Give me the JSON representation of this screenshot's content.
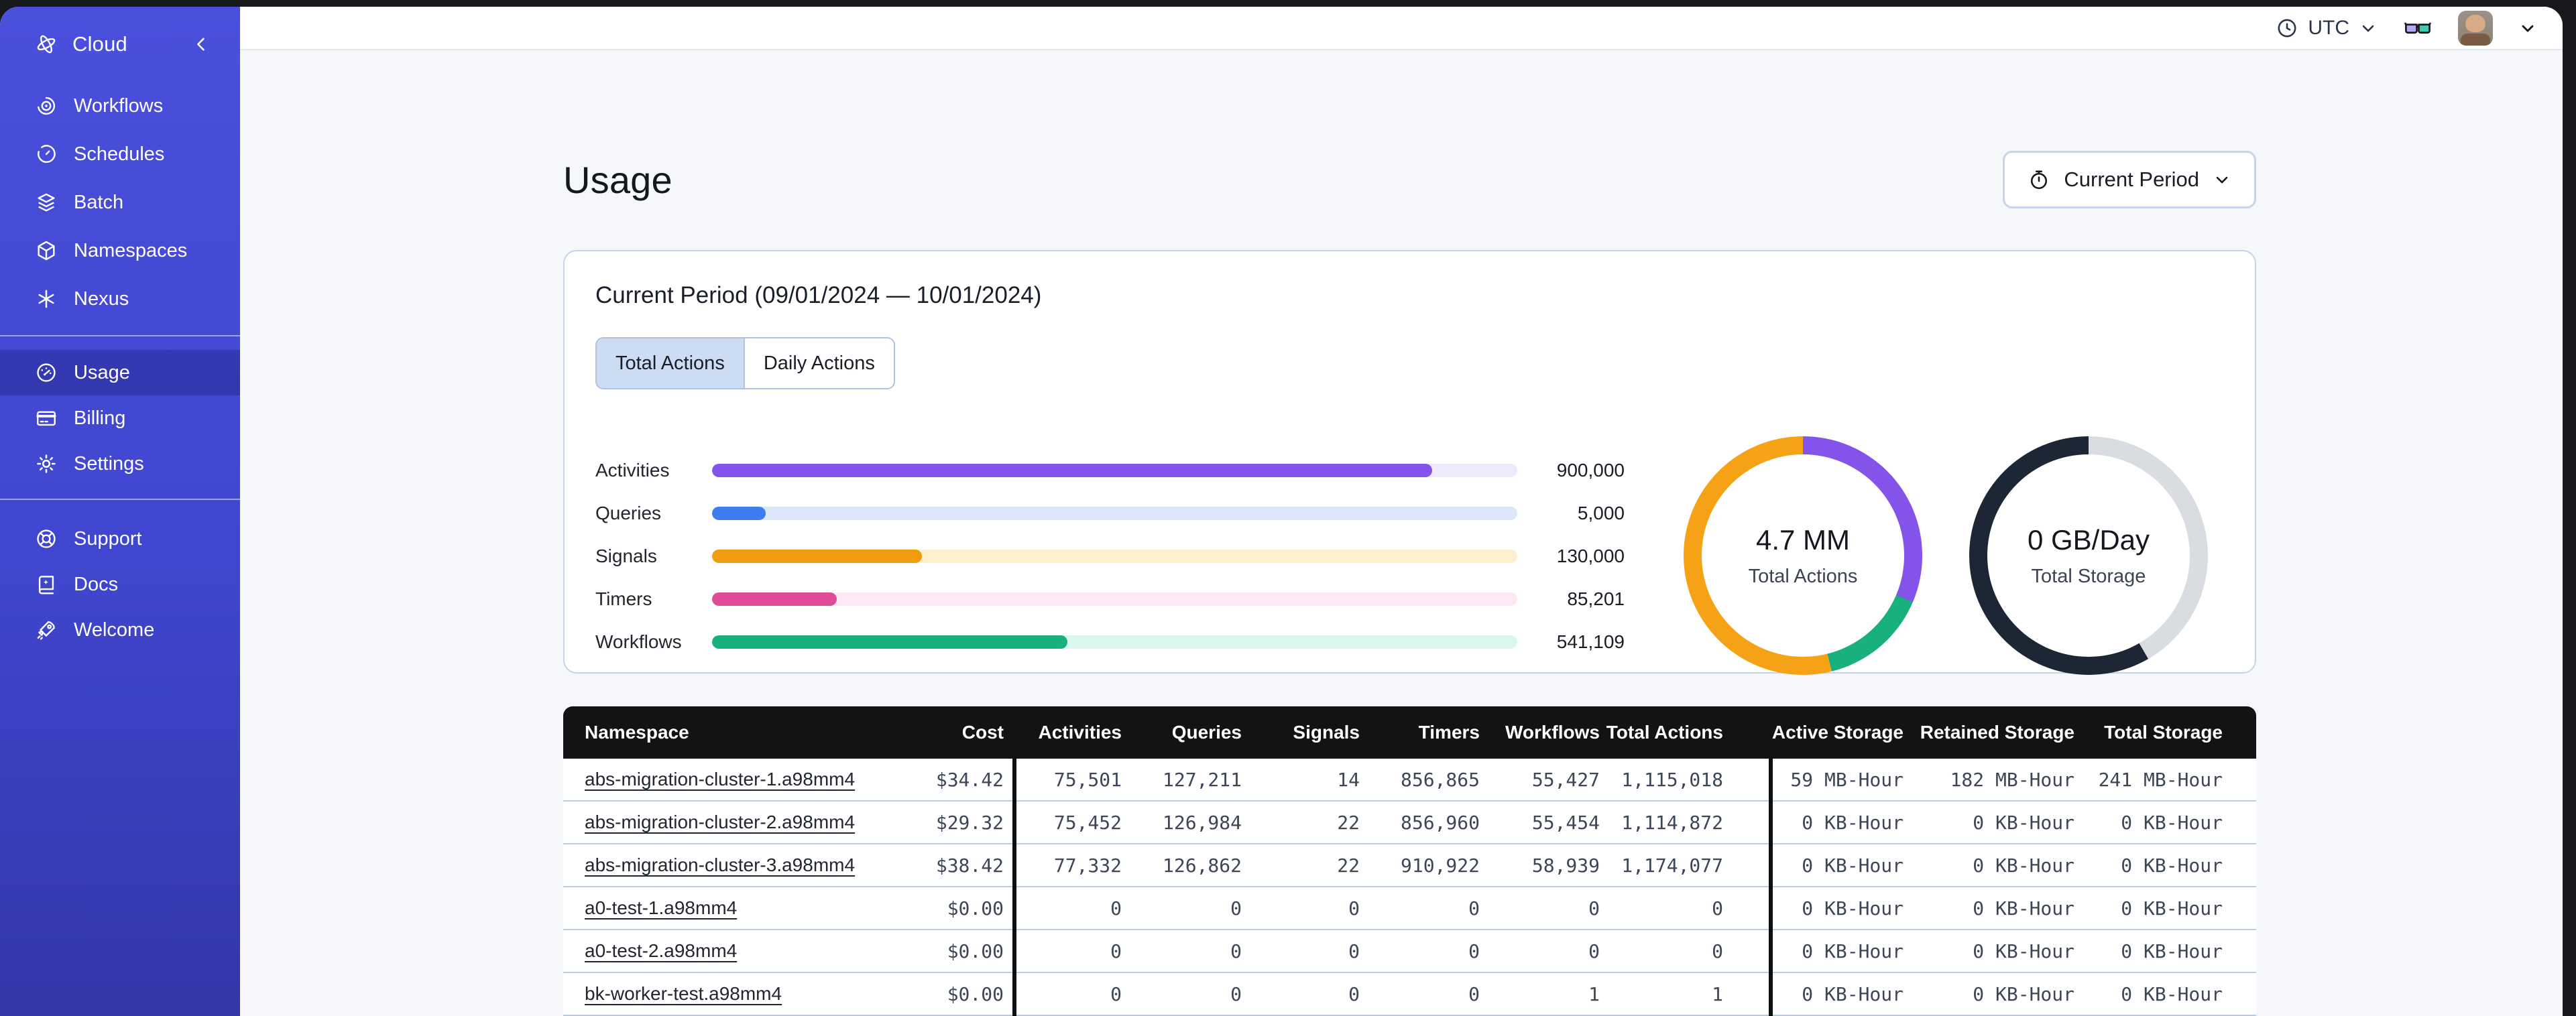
{
  "topbar": {
    "timezone_label": "UTC"
  },
  "sidebar": {
    "brand": "Cloud",
    "items": [
      {
        "label": "Workflows"
      },
      {
        "label": "Schedules"
      },
      {
        "label": "Batch"
      },
      {
        "label": "Namespaces"
      },
      {
        "label": "Nexus"
      }
    ],
    "account_items": [
      {
        "label": "Usage",
        "active": true
      },
      {
        "label": "Billing",
        "active": false
      },
      {
        "label": "Settings",
        "active": false
      }
    ],
    "footer_items": [
      {
        "label": "Support"
      },
      {
        "label": "Docs"
      },
      {
        "label": "Welcome"
      }
    ]
  },
  "page": {
    "title": "Usage",
    "period_button_label": "Current Period",
    "card_title": "Current Period (09/01/2024 — 10/01/2024)",
    "tabs": [
      {
        "label": "Total Actions",
        "selected": true
      },
      {
        "label": "Daily Actions",
        "selected": false
      }
    ]
  },
  "chart_data": [
    {
      "type": "bar",
      "orientation": "horizontal",
      "categories": [
        "Activities",
        "Queries",
        "Signals",
        "Timers",
        "Workflows"
      ],
      "values": [
        900000,
        5000,
        130000,
        85201,
        541109
      ],
      "value_labels": [
        "900,000",
        "5,000",
        "130,000",
        "85,201",
        "541,109"
      ],
      "fill_percents": [
        89.4,
        6.7,
        26.1,
        15.5,
        44.1
      ],
      "bar_colors": [
        "#8353EA",
        "#3D7DF0",
        "#F09C0C",
        "#DE4C99",
        "#17B07E"
      ],
      "track_colors": [
        "#EFEAFB",
        "#DCE8FA",
        "#FBF0CE",
        "#FBE8F5",
        "#D9F7EA"
      ]
    },
    {
      "type": "donut",
      "center_value": "4.7 MM",
      "center_label": "Total Actions",
      "segments": [
        {
          "name": "segment-1",
          "color": "#8353EA",
          "start_deg": 0,
          "end_deg": 113
        },
        {
          "name": "segment-2",
          "color": "#17B07E",
          "start_deg": 113,
          "end_deg": 166
        },
        {
          "name": "segment-3",
          "color": "#F5A217",
          "start_deg": 166,
          "end_deg": 360
        }
      ]
    },
    {
      "type": "donut",
      "center_value": "0 GB/Day",
      "center_label": "Total Storage",
      "segments": [
        {
          "name": "segment-1",
          "color": "#D9DCE1",
          "start_deg": 0,
          "end_deg": 150
        },
        {
          "name": "segment-2",
          "color": "#1D2635",
          "start_deg": 150,
          "end_deg": 360
        }
      ]
    }
  ],
  "table": {
    "columns": [
      "Namespace",
      "Cost",
      "Activities",
      "Queries",
      "Signals",
      "Timers",
      "Workflows",
      "Total Actions",
      "Active Storage",
      "Retained Storage",
      "Total Storage"
    ],
    "rows": [
      {
        "namespace": "abs-migration-cluster-1.a98mm4",
        "cost": "$34.42",
        "activities": "75,501",
        "queries": "127,211",
        "signals": "14",
        "timers": "856,865",
        "workflows": "55,427",
        "total_actions": "1,115,018",
        "active_storage": "59 MB-Hour",
        "retained_storage": "182 MB-Hour",
        "total_storage": "241 MB-Hour"
      },
      {
        "namespace": "abs-migration-cluster-2.a98mm4",
        "cost": "$29.32",
        "activities": "75,452",
        "queries": "126,984",
        "signals": "22",
        "timers": "856,960",
        "workflows": "55,454",
        "total_actions": "1,114,872",
        "active_storage": "0 KB-Hour",
        "retained_storage": "0 KB-Hour",
        "total_storage": "0 KB-Hour"
      },
      {
        "namespace": "abs-migration-cluster-3.a98mm4",
        "cost": "$38.42",
        "activities": "77,332",
        "queries": "126,862",
        "signals": "22",
        "timers": "910,922",
        "workflows": "58,939",
        "total_actions": "1,174,077",
        "active_storage": "0 KB-Hour",
        "retained_storage": "0 KB-Hour",
        "total_storage": "0 KB-Hour"
      },
      {
        "namespace": "a0-test-1.a98mm4",
        "cost": "$0.00",
        "activities": "0",
        "queries": "0",
        "signals": "0",
        "timers": "0",
        "workflows": "0",
        "total_actions": "0",
        "active_storage": "0 KB-Hour",
        "retained_storage": "0 KB-Hour",
        "total_storage": "0 KB-Hour"
      },
      {
        "namespace": "a0-test-2.a98mm4",
        "cost": "$0.00",
        "activities": "0",
        "queries": "0",
        "signals": "0",
        "timers": "0",
        "workflows": "0",
        "total_actions": "0",
        "active_storage": "0 KB-Hour",
        "retained_storage": "0 KB-Hour",
        "total_storage": "0 KB-Hour"
      },
      {
        "namespace": "bk-worker-test.a98mm4",
        "cost": "$0.00",
        "activities": "0",
        "queries": "0",
        "signals": "0",
        "timers": "0",
        "workflows": "1",
        "total_actions": "1",
        "active_storage": "0 KB-Hour",
        "retained_storage": "0 KB-Hour",
        "total_storage": "0 KB-Hour"
      }
    ]
  }
}
